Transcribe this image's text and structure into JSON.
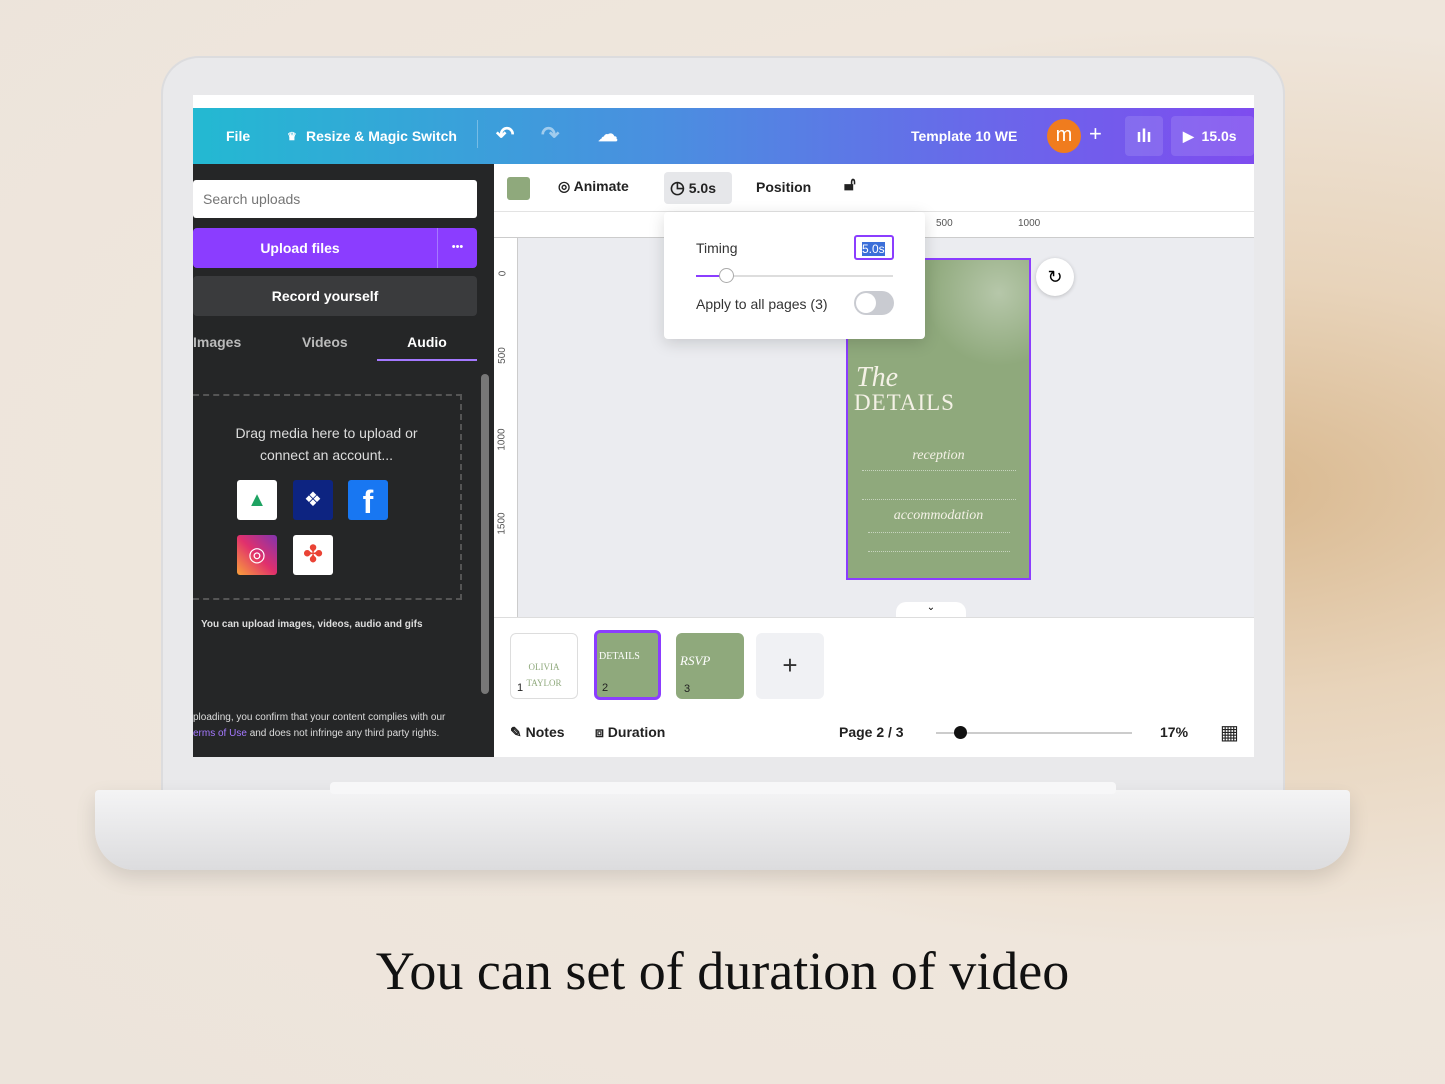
{
  "header": {
    "file": "File",
    "resize": "Resize & Magic Switch",
    "title": "Template 10 WE",
    "avatar": "m",
    "play_duration": "15.0s"
  },
  "sidebar": {
    "search_placeholder": "Search uploads",
    "upload": "Upload files",
    "more": "•••",
    "record": "Record yourself",
    "tabs": [
      {
        "label": "Images"
      },
      {
        "label": "Videos"
      },
      {
        "label": "Audio",
        "active": true
      }
    ],
    "drop_text_1": "Drag media here to upload or",
    "drop_text_2": "connect an account...",
    "services": [
      "google-drive",
      "dropbox",
      "facebook",
      "instagram",
      "google-photos"
    ],
    "hint": "You can upload images, videos, audio and gifs",
    "legal_1": "ploading, you confirm that your content complies with our",
    "legal_link": "erms of Use",
    "legal_2": "and does not infringe any third party rights."
  },
  "toolbar": {
    "color": "#8fa97c",
    "animate": "Animate",
    "duration": "5.0s",
    "position": "Position"
  },
  "timing_popup": {
    "label": "Timing",
    "value": "5.0s",
    "apply_all": "Apply to all pages (3)",
    "apply_all_on": false
  },
  "rulers": {
    "top": [
      "500",
      "1000"
    ],
    "left": [
      "0",
      "500",
      "1000",
      "1500"
    ]
  },
  "design": {
    "the": "The",
    "details": "DETAILS",
    "reception": "reception",
    "accommodation": "accommodation"
  },
  "pages": [
    {
      "num": "1",
      "text_1": "OLIVIA",
      "text_2": "TAYLOR"
    },
    {
      "num": "2",
      "text": "DETAILS",
      "selected": true
    },
    {
      "num": "3",
      "text": "RSVP"
    }
  ],
  "footer": {
    "notes": "Notes",
    "duration": "Duration",
    "page": "Page 2 / 3",
    "zoom": "17%",
    "zoom_value": 17
  },
  "caption": "You can set of duration of video",
  "colors": {
    "accent": "#8b3dff",
    "sage": "#8fa97c",
    "avatar": "#f07c1e"
  }
}
